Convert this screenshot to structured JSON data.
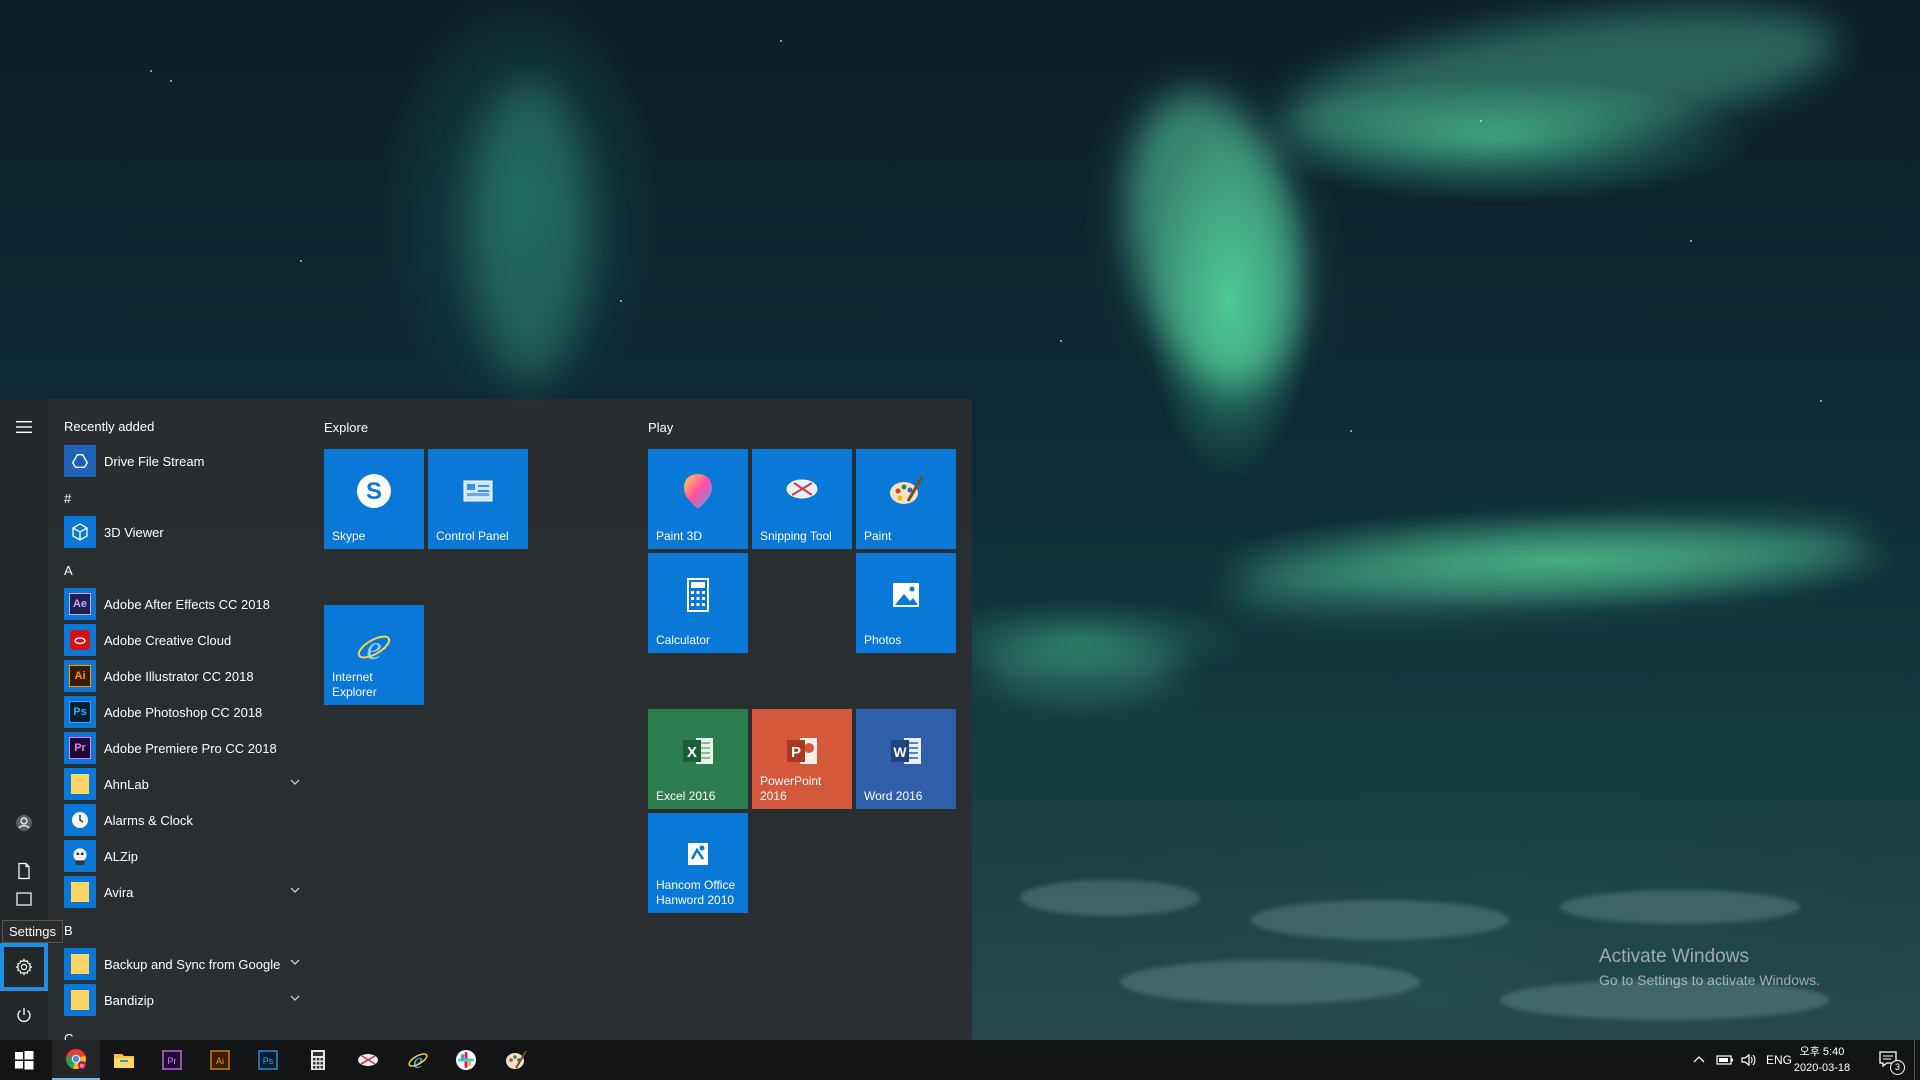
{
  "desktop": {
    "activate_title": "Activate Windows",
    "activate_sub": "Go to Settings to activate Windows."
  },
  "start_menu": {
    "rail": {
      "tooltip": "Settings"
    },
    "app_list": {
      "recently_added_header": "Recently added",
      "hash_header": "#",
      "a_header": "A",
      "b_header": "B",
      "c_header": "C",
      "items": [
        {
          "label": "Drive File Stream",
          "icon": "drive-icon",
          "icon_text": "",
          "color": "#1e63b8",
          "expandable": false
        },
        {
          "label": "3D Viewer",
          "icon": "cube-icon",
          "icon_text": "",
          "color": "#0a78d7",
          "expandable": false
        },
        {
          "label": "Adobe After Effects CC 2018",
          "icon": "after-effects-icon",
          "icon_text": "Ae",
          "color": "#1f1f52",
          "expandable": false
        },
        {
          "label": "Adobe Creative Cloud",
          "icon": "creative-cloud-icon",
          "icon_text": "",
          "color": "#d1121a",
          "expandable": false
        },
        {
          "label": "Adobe Illustrator CC 2018",
          "icon": "illustrator-icon",
          "icon_text": "Ai",
          "color": "#3a1a00",
          "expandable": false
        },
        {
          "label": "Adobe Photoshop CC 2018",
          "icon": "photoshop-icon",
          "icon_text": "Ps",
          "color": "#061e2e",
          "expandable": false
        },
        {
          "label": "Adobe Premiere Pro CC 2018",
          "icon": "premiere-icon",
          "icon_text": "Pr",
          "color": "#1f0a34",
          "expandable": false
        },
        {
          "label": "AhnLab",
          "icon": "folder-icon",
          "icon_text": "",
          "color": "#0a78d7",
          "expandable": true
        },
        {
          "label": "Alarms & Clock",
          "icon": "clock-icon",
          "icon_text": "",
          "color": "#0a78d7",
          "expandable": false
        },
        {
          "label": "ALZip",
          "icon": "alzip-icon",
          "icon_text": "",
          "color": "#0a78d7",
          "expandable": false
        },
        {
          "label": "Avira",
          "icon": "folder-icon",
          "icon_text": "",
          "color": "#0a78d7",
          "expandable": true
        },
        {
          "label": "Backup and Sync from Google",
          "icon": "folder-icon",
          "icon_text": "",
          "color": "#0a78d7",
          "expandable": true
        },
        {
          "label": "Bandizip",
          "icon": "folder-icon",
          "icon_text": "",
          "color": "#0a78d7",
          "expandable": true
        }
      ]
    },
    "groups": {
      "explore": "Explore",
      "play": "Play"
    },
    "tiles": {
      "skype": "Skype",
      "control_panel": "Control Panel",
      "internet_explorer": "Internet Explorer",
      "paint3d": "Paint 3D",
      "snipping": "Snipping Tool",
      "paint": "Paint",
      "calculator": "Calculator",
      "photos": "Photos",
      "excel": "Excel 2016",
      "powerpoint": "PowerPoint 2016",
      "word": "Word 2016",
      "hancom": "Hancom Office Hanword 2010"
    },
    "colors": {
      "tile_blue": "#0a78d7",
      "excel": "#2e7d4f",
      "powerpoint": "#d4583b",
      "word": "#2f5fa8",
      "highlight": "#1e90e6"
    }
  },
  "taskbar": {
    "language": "ENG",
    "time": "오후 5:40",
    "date": "2020-03-18",
    "notification_count": "3"
  }
}
